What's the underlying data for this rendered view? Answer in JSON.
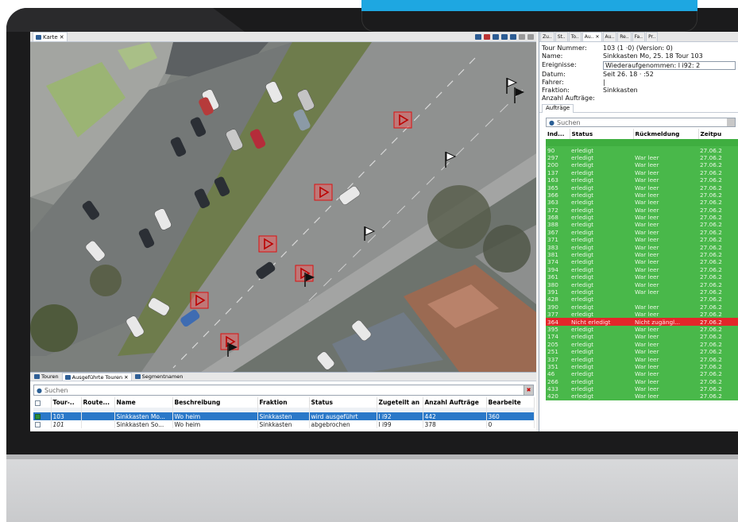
{
  "map_view": {
    "tab_label": "Karte"
  },
  "bottom_tabs": [
    "Touren",
    "Ausgeführte Touren",
    "Segmentnamen"
  ],
  "tour_search": {
    "placeholder": "Suchen"
  },
  "tour_table": {
    "columns": [
      "",
      "Tour-..",
      "Route...",
      "Name",
      "Beschreibung",
      "Fraktion",
      "Status",
      "Zugeteilt an",
      "Anzahl Aufträge",
      "Bearbeite"
    ],
    "rows": [
      {
        "selected": true,
        "checked": true,
        "tour": "103",
        "route": "",
        "name": "Sinkkasten Mo...",
        "beschreibung": "Wo           heim",
        "fraktion": "Sinkkasten",
        "status": "wird ausgeführt",
        "zugeteilt": "l         i92",
        "anzahl": "442",
        "bearbeitet": "360"
      },
      {
        "selected": false,
        "checked": false,
        "tour": "101",
        "route": "",
        "name": "Sinkkasten So...",
        "beschreibung": "Wo           heim",
        "fraktion": "Sinkkasten",
        "status": "abgebrochen",
        "zugeteilt": "l         i99",
        "anzahl": "378",
        "bearbeitet": "0"
      }
    ]
  },
  "side_tabs": [
    "Zu..",
    "St..",
    "To..",
    "Au..",
    "Au..",
    "Re..",
    "Fa..",
    "Pr.."
  ],
  "tour_details": {
    "labels": {
      "tour_nummer": "Tour Nummer:",
      "name": "Name:",
      "ereignisse": "Ereignisse:",
      "datum": "Datum:",
      "fahrer": "Fahrer:",
      "fraktion": "Fraktion:",
      "anzahl": "Anzahl Aufträge:"
    },
    "values": {
      "tour_nummer": "103 (1                  ·0) (Version: 0)",
      "name": "Sinkkasten Mo, 25.     18 Tour 103",
      "ereignisse": "Wiederaufgenommen: l          i92: 2",
      "datum": "Seit 26.        18 ·       :52",
      "fahrer": "|",
      "fraktion": "Sinkkasten",
      "anzahl": ""
    }
  },
  "orders_tab": "Aufträge",
  "orders_search": {
    "placeholder": "Suchen"
  },
  "orders_table": {
    "columns": [
      "Ind...",
      "Status",
      "Rückmeldung",
      "Zeitpu"
    ],
    "rows": [
      [
        "",
        "",
        "",
        ""
      ],
      [
        "90",
        "erledigt",
        "",
        "27.06.2"
      ],
      [
        "297",
        "erledigt",
        "War leer",
        "27.06.2"
      ],
      [
        "200",
        "erledigt",
        "War leer",
        "27.06.2"
      ],
      [
        "137",
        "erledigt",
        "War leer",
        "27.06.2"
      ],
      [
        "163",
        "erledigt",
        "War leer",
        "27.06.2"
      ],
      [
        "365",
        "erledigt",
        "War leer",
        "27.06.2"
      ],
      [
        "366",
        "erledigt",
        "War leer",
        "27.06.2"
      ],
      [
        "363",
        "erledigt",
        "War leer",
        "27.06.2"
      ],
      [
        "372",
        "erledigt",
        "War leer",
        "27.06.2"
      ],
      [
        "368",
        "erledigt",
        "War leer",
        "27.06.2"
      ],
      [
        "388",
        "erledigt",
        "War leer",
        "27.06.2"
      ],
      [
        "367",
        "erledigt",
        "War leer",
        "27.06.2"
      ],
      [
        "371",
        "erledigt",
        "War leer",
        "27.06.2"
      ],
      [
        "383",
        "erledigt",
        "War leer",
        "27.06.2"
      ],
      [
        "381",
        "erledigt",
        "War leer",
        "27.06.2"
      ],
      [
        "374",
        "erledigt",
        "War leer",
        "27.06.2"
      ],
      [
        "394",
        "erledigt",
        "War leer",
        "27.06.2"
      ],
      [
        "361",
        "erledigt",
        "War leer",
        "27.06.2"
      ],
      [
        "380",
        "erledigt",
        "War leer",
        "27.06.2"
      ],
      [
        "391",
        "erledigt",
        "War leer",
        "27.06.2"
      ],
      [
        "428",
        "erledigt",
        "",
        "27.06.2"
      ],
      [
        "390",
        "erledigt",
        "War leer",
        "27.06.2"
      ],
      [
        "377",
        "erledigt",
        "War leer",
        "27.06.2"
      ],
      [
        "364",
        "Nicht erledigt",
        "Nicht zugängl...",
        "27.06.2"
      ],
      [
        "395",
        "erledigt",
        "War leer",
        "27.06.2"
      ],
      [
        "174",
        "erledigt",
        "War leer",
        "27.06.2"
      ],
      [
        "205",
        "erledigt",
        "War leer",
        "27.06.2"
      ],
      [
        "251",
        "erledigt",
        "War leer",
        "27.06.2"
      ],
      [
        "337",
        "erledigt",
        "War leer",
        "27.06.2"
      ],
      [
        "351",
        "erledigt",
        "War leer",
        "27.06.2"
      ],
      [
        "46",
        "erledigt",
        "War leer",
        "27.06.2"
      ],
      [
        "266",
        "erledigt",
        "War leer",
        "27.06.2"
      ],
      [
        "433",
        "erledigt",
        "War leer",
        "27.06.2"
      ],
      [
        "420",
        "erledigt",
        "War leer",
        "27.06.2"
      ]
    ]
  },
  "colors": {
    "accent_blue": "#1ea7e1",
    "done_green": "#49b84a",
    "failed_red": "#e3262a",
    "selection_blue": "#2a78c8"
  }
}
